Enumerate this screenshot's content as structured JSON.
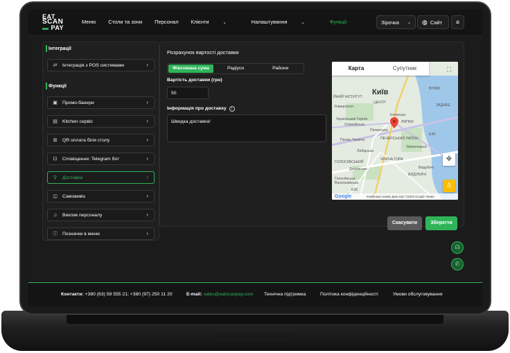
{
  "header": {
    "logo_line1": "EAT",
    "logo_line2": "SCAN",
    "logo_line3": "PAY",
    "nav": [
      {
        "label": "Меню"
      },
      {
        "label": "Столи та зони"
      },
      {
        "label": "Персонал"
      },
      {
        "label": "Клієнти"
      },
      {
        "label": "Налаштування"
      },
      {
        "label": "Функції"
      }
    ],
    "venue_select": "Зірочка",
    "site_button": "Сайт"
  },
  "sidebar": {
    "section1": "Інтеграції",
    "integration_item": "Інтеграція з POS системами",
    "section2": "Функції",
    "items": [
      {
        "label": "Промо-банери",
        "icon": "image-icon"
      },
      {
        "label": "Kitchen сервіс",
        "icon": "book-icon"
      },
      {
        "label": "QR оплата біля столу",
        "icon": "qr-icon"
      },
      {
        "label": "Сповіщення: Telegram бот",
        "icon": "bot-icon"
      },
      {
        "label": "Доставка",
        "icon": "bike-icon"
      },
      {
        "label": "Самовивіз",
        "icon": "bag-icon"
      },
      {
        "label": "Виклик персоналу",
        "icon": "bell-icon"
      },
      {
        "label": "Позначки в меню",
        "icon": "info-icon"
      }
    ],
    "active_index": 4
  },
  "main": {
    "title": "Розрахунок вартості доставки",
    "segments": [
      "Фіксована сума",
      "Радіуси",
      "Райони"
    ],
    "active_segment": 0,
    "price_label": "Вартість доставки (грн)",
    "price_value": "50",
    "info_label": "Інформація про доставку",
    "info_value": "Швидка доставка!",
    "cancel_label": "Скасувати",
    "save_label": "Зберегти"
  },
  "map": {
    "tab_map": "Карта",
    "tab_satellite": "Супутник",
    "city_label": "Київ",
    "labels": [
      "ЙНИЙ ІНСТИТУТ",
      "Університет",
      "Кловська",
      "Українських Героїв",
      "Олімпійська",
      "Печерська",
      "Палац Україна",
      "Звіринецька",
      "Либідська",
      "Деміївська",
      "ГОЛОСІЇВСЬКИЙ",
      "ЧОРНА ГОРА",
      "Голосіївська",
      "ВИДУБИЧІ",
      "ЦЕНТР",
      "ЛИПКИ",
      "Видубичі",
      "Васильківська",
      "ПЕЧЕРСЬКИЙ РАЙОН",
      "E95",
      "E40",
      "ЗАДИБЕ",
      "ВУМІВ"
    ],
    "footer_text": "Комбінації клавіш   Дані карт ©2025 Google   Умови",
    "google": "Google"
  },
  "footer": {
    "contacts_label": "Контакти:",
    "contacts_value": "+380 (63) 59 555 21; +380 (97) 250 11 20",
    "email_label": "E-mail:",
    "email_value": "sales@eatscanpay.com",
    "support": "Технічна підтримка",
    "privacy": "Політика конфіденційності",
    "terms": "Умови обслуговування"
  },
  "colors": {
    "accent": "#2fb45a",
    "background": "#1b1b1b",
    "panel": "#1f1f1f"
  }
}
